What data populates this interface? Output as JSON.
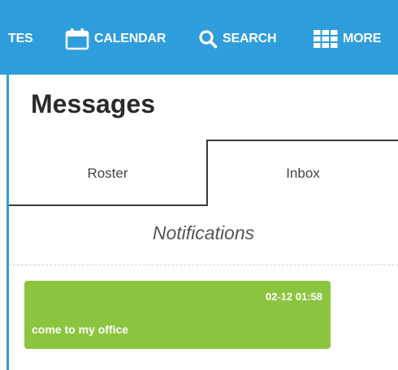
{
  "nav": {
    "notes_label": "TES",
    "calendar_label": "CALENDAR",
    "search_label": "SEARCH",
    "more_label": "MORE",
    "calendar_icon": "calendar-icon",
    "search_icon": "search-icon",
    "more_icon": "grid-icon"
  },
  "page": {
    "title": "Messages"
  },
  "tabs": [
    {
      "label": "Roster",
      "active": false
    },
    {
      "label": "Inbox",
      "active": true
    }
  ],
  "notifications": {
    "header": "Notifications",
    "items": [
      {
        "time": "02-12 01:58",
        "text": "come to my office"
      }
    ]
  },
  "colors": {
    "topbar": "#2f9ddb",
    "message_card": "#8bc53f"
  }
}
